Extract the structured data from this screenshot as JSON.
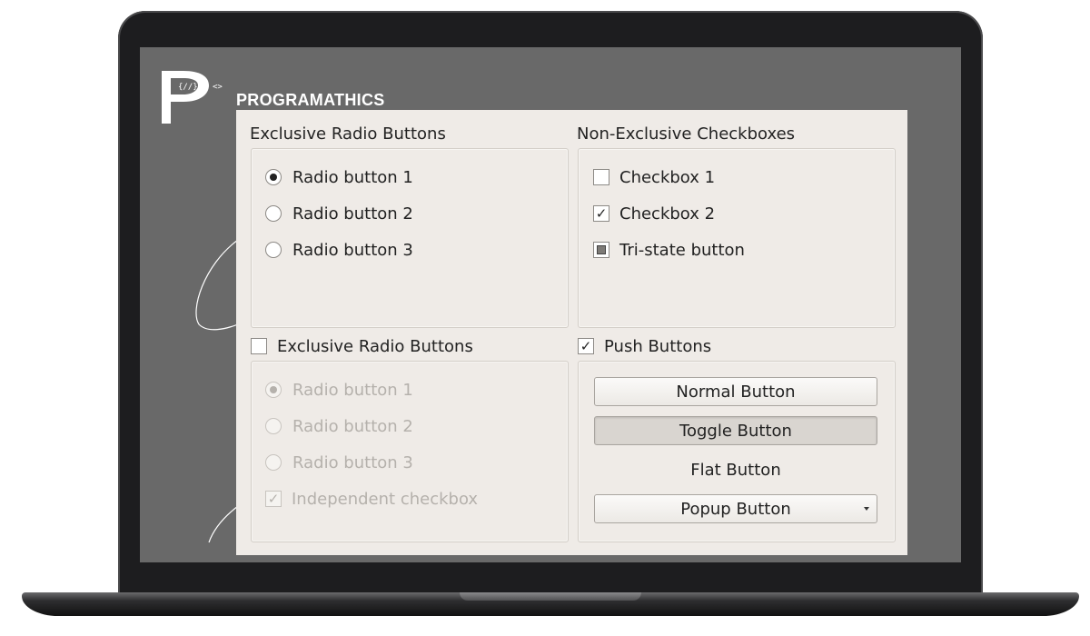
{
  "brand": {
    "name": "PROGRAMATHICS"
  },
  "colors": {
    "screen": "#696969",
    "window": "#efebe7",
    "disabled_text": "#b5b1ac"
  },
  "top_left_group": {
    "title": "Exclusive Radio Buttons",
    "options": [
      {
        "label": "Radio button 1",
        "checked": true
      },
      {
        "label": "Radio button 2",
        "checked": false
      },
      {
        "label": "Radio button 3",
        "checked": false
      }
    ]
  },
  "top_right_group": {
    "title": "Non-Exclusive Checkboxes",
    "options": [
      {
        "label": "Checkbox 1",
        "state": "unchecked"
      },
      {
        "label": "Checkbox 2",
        "state": "checked",
        "mark": "✓"
      },
      {
        "label": "Tri-state button",
        "state": "partial"
      }
    ]
  },
  "bottom_left_group": {
    "title": "Exclusive Radio Buttons",
    "checked": false,
    "enabled": false,
    "options": [
      {
        "label": "Radio button 1",
        "checked": true
      },
      {
        "label": "Radio button 2",
        "checked": false
      },
      {
        "label": "Radio button 3",
        "checked": false
      }
    ],
    "independent_checkbox": {
      "label": "Independent checkbox",
      "checked": true,
      "mark": "✓"
    }
  },
  "bottom_right_group": {
    "title": "Push Buttons",
    "checked": true,
    "mark": "✓",
    "buttons": {
      "normal": "Normal Button",
      "toggle": "Toggle Button",
      "flat": "Flat Button",
      "popup": "Popup Button"
    }
  }
}
